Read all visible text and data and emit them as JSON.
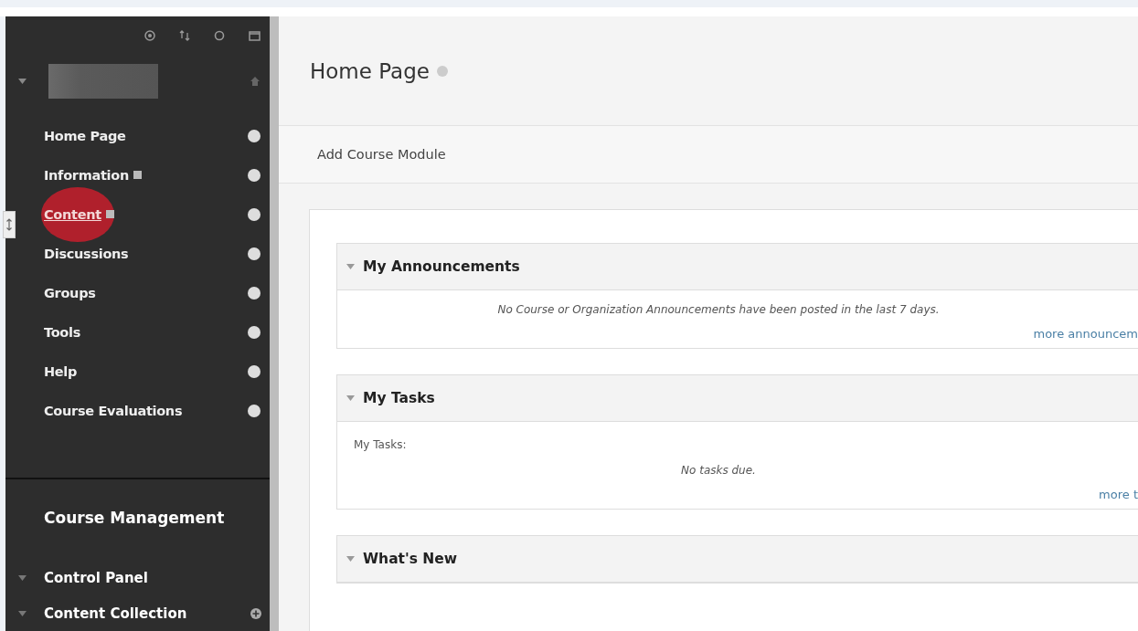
{
  "sidebar": {
    "course_menu": [
      {
        "label": "Home Page",
        "selected": false,
        "badge": false
      },
      {
        "label": "Information",
        "selected": false,
        "badge": true
      },
      {
        "label": "Content",
        "selected": true,
        "badge": true
      },
      {
        "label": "Discussions",
        "selected": false,
        "badge": false
      },
      {
        "label": "Groups",
        "selected": false,
        "badge": false
      },
      {
        "label": "Tools",
        "selected": false,
        "badge": false
      },
      {
        "label": "Help",
        "selected": false,
        "badge": false
      },
      {
        "label": "Course Evaluations",
        "selected": false,
        "badge": false
      }
    ],
    "management_title": "Course Management",
    "management_items": [
      {
        "label": "Control Panel",
        "expanded": true,
        "add": false
      },
      {
        "label": "Content Collection",
        "expanded": true,
        "add": true
      }
    ]
  },
  "page": {
    "title": "Home Page",
    "action": "Add Course Module",
    "modules": [
      {
        "title": "My Announcements",
        "expanded": true,
        "message": "No Course or Organization Announcements have been posted in the last 7 days.",
        "link": "more announcem"
      },
      {
        "title": "My Tasks",
        "expanded": true,
        "label": "My Tasks:",
        "message": "No tasks due.",
        "link": "more t"
      },
      {
        "title": "What's New",
        "expanded": true
      }
    ]
  }
}
